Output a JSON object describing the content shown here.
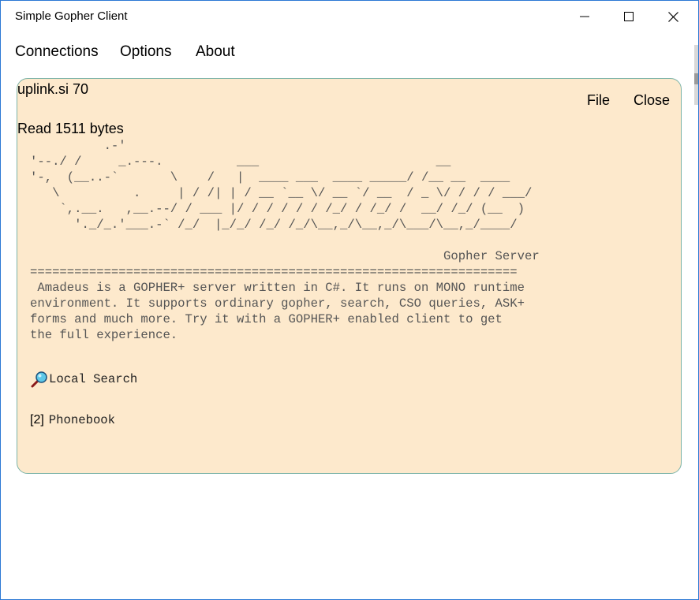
{
  "window": {
    "title": "Simple Gopher Client"
  },
  "menu": [
    "Connections",
    "Options",
    "About"
  ],
  "panel": {
    "host": "uplink.si 70",
    "file_label": "File",
    "close_label": "Close",
    "status": "Read 1511 bytes"
  },
  "content": {
    "ascii_text": "          .-'\n'--./ /     _.---.          ___                        __\n'-,  (__..-`       \\    /   |  ____ ___  ____ _____/ /__ __  ____\n   \\          .     | / /| | / __ `__ \\/ __ `/ __  / _ \\/ / / / ___/\n    `,.__.   ,__.--/ / ___ |/ / / / / / /_/ / /_/ /  __/ /_/ (__  )\n      '._/_.'___.-` /_/  |_/_/ /_/ /_/\\__,_/\\__,_/\\___/\\__,_/____/\n\n                                                        Gopher Server\n==================================================================\n Amadeus is a GOPHER+ server written in C#. It runs on MONO runtime\nenvironment. It supports ordinary gopher, search, CSO queries, ASK+\nforms and much more. Try it with a GOPHER+ enabled client to get\nthe full experience.",
    "items": [
      {
        "type": "search",
        "icon": "magnifier-icon",
        "label": "Local Search"
      },
      {
        "type": "[2]",
        "label": "Phonebook"
      }
    ]
  },
  "colors": {
    "panel_bg": "#fde9cc",
    "panel_border": "#7db4a8",
    "window_border": "#2b78d4",
    "text_gray": "#555555"
  }
}
